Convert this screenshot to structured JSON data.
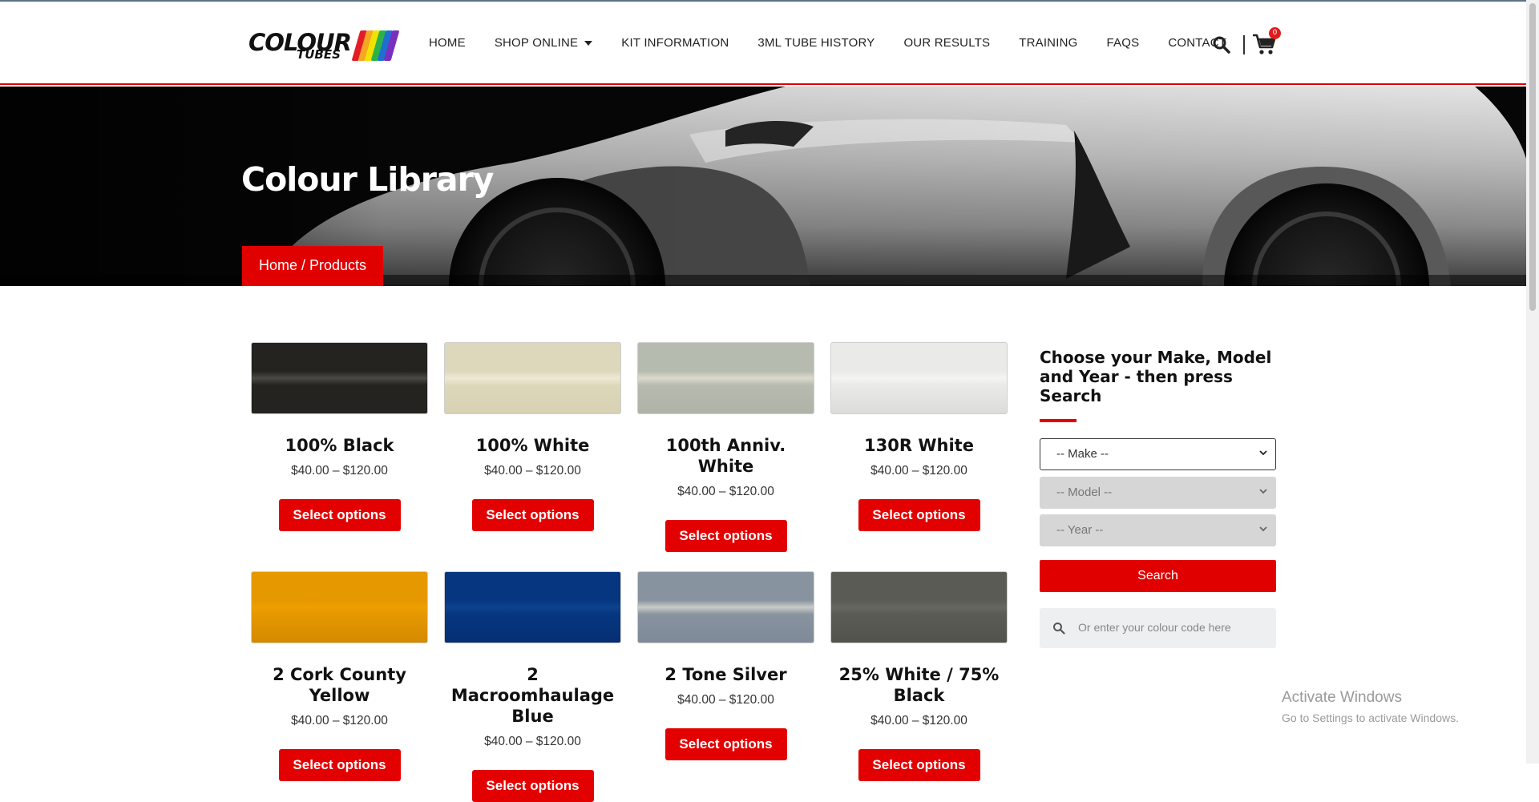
{
  "logo": {
    "word1": "COLOUR",
    "word2": "TUBES",
    "stripe_colors": [
      "#e31d25",
      "#f5a623",
      "#f2e200",
      "#2bb34a",
      "#1f6fd1",
      "#7b2fbe"
    ]
  },
  "nav": {
    "items": [
      "HOME",
      "SHOP ONLINE",
      "KIT INFORMATION",
      "3ML TUBE HISTORY",
      "OUR RESULTS",
      "TRAINING",
      "FAQS",
      "CONTACT"
    ],
    "cart_count": "0"
  },
  "hero": {
    "title": "Colour Library",
    "breadcrumb": "Home / Products"
  },
  "products": [
    {
      "name": "100% Black",
      "price": "$40.00 – $120.00",
      "button": "Select options",
      "colors": [
        "#24231f",
        "#4a4944",
        "#24231f"
      ]
    },
    {
      "name": "100% White",
      "price": "$40.00 – $120.00",
      "button": "Select options",
      "colors": [
        "#ddd7bb",
        "#eee9d4",
        "#d8d1b2"
      ]
    },
    {
      "name": "100th Anniv. White",
      "price": "$40.00 – $120.00",
      "button": "Select options",
      "colors": [
        "#b6bbb0",
        "#ddd9cc",
        "#aeb3a8"
      ]
    },
    {
      "name": "130R White",
      "price": "$40.00 – $120.00",
      "button": "Select options",
      "colors": [
        "#eaebe8",
        "#f4f4f2",
        "#dcdcd8"
      ]
    },
    {
      "name": "2 Cork County Yellow",
      "price": "$40.00 – $120.00",
      "button": "Select options",
      "colors": [
        "#e59800",
        "#ee9f00",
        "#d48a00"
      ]
    },
    {
      "name": "2 Macroomhaulage Blue",
      "price": "$40.00 – $120.00",
      "button": "Select options",
      "colors": [
        "#06367f",
        "#0c428f",
        "#062f73"
      ]
    },
    {
      "name": "2 Tone Silver",
      "price": "$40.00 – $120.00",
      "button": "Select options",
      "colors": [
        "#8893a0",
        "#c9ccc6",
        "#7f8a98"
      ]
    },
    {
      "name": "25% White / 75% Black",
      "price": "$40.00 – $120.00",
      "button": "Select options",
      "colors": [
        "#5a5b55",
        "#666760",
        "#52534d"
      ]
    }
  ],
  "sidebar": {
    "title": "Choose your Make, Model and Year - then press Search",
    "make": "-- Make --",
    "model": "-- Model --",
    "year": "-- Year --",
    "search_button": "Search",
    "code_placeholder": "Or enter your colour code here"
  },
  "watermark": {
    "line1": "Activate Windows",
    "line2": "Go to Settings to activate Windows."
  },
  "colors": {
    "accent": "#e10000",
    "text": "#222222"
  }
}
